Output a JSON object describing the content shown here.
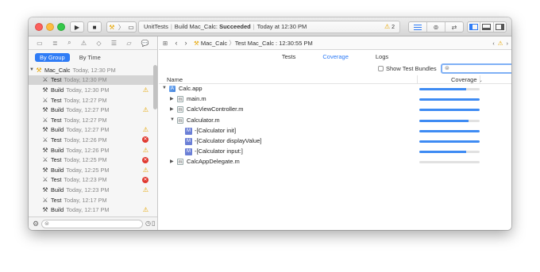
{
  "toolbar": {
    "run_label": "▶",
    "stop_label": "■",
    "activity": {
      "project": "UnitTests",
      "action": "Build Mac_Calc:",
      "status": "Succeeded",
      "time": "Today at 12:30 PM",
      "warning_count": "2"
    }
  },
  "navigator": {
    "filter": {
      "by_group": "By Group",
      "by_time": "By Time"
    },
    "root": {
      "name": "Mac_Calc",
      "time": "Today, 12:30 PM"
    },
    "items": [
      {
        "action": "Test",
        "time": "Today, 12:30 PM",
        "badge": "none",
        "selected": true
      },
      {
        "action": "Build",
        "time": "Today, 12:30 PM",
        "badge": "warning"
      },
      {
        "action": "Test",
        "time": "Today, 12:27 PM",
        "badge": "none"
      },
      {
        "action": "Build",
        "time": "Today, 12:27 PM",
        "badge": "warning"
      },
      {
        "action": "Test",
        "time": "Today, 12:27 PM",
        "badge": "none"
      },
      {
        "action": "Build",
        "time": "Today, 12:27 PM",
        "badge": "warning"
      },
      {
        "action": "Test",
        "time": "Today, 12:26 PM",
        "badge": "error"
      },
      {
        "action": "Build",
        "time": "Today, 12:26 PM",
        "badge": "warning"
      },
      {
        "action": "Test",
        "time": "Today, 12:25 PM",
        "badge": "error"
      },
      {
        "action": "Build",
        "time": "Today, 12:25 PM",
        "badge": "warning"
      },
      {
        "action": "Test",
        "time": "Today, 12:23 PM",
        "badge": "error"
      },
      {
        "action": "Build",
        "time": "Today, 12:23 PM",
        "badge": "warning"
      },
      {
        "action": "Test",
        "time": "Today, 12:17 PM",
        "badge": "none"
      },
      {
        "action": "Build",
        "time": "Today, 12:17 PM",
        "badge": "warning"
      }
    ]
  },
  "jump_bar": {
    "project": "Mac_Calc",
    "separator": "〉",
    "report": "Test Mac_Calc : 12:30:55 PM"
  },
  "tabs": [
    {
      "label": "Tests",
      "active": false
    },
    {
      "label": "Coverage",
      "active": true
    },
    {
      "label": "Logs",
      "active": false
    }
  ],
  "options": {
    "show_test_bundles": "Show Test Bundles"
  },
  "coverage": {
    "header": {
      "name": "Name",
      "coverage": "Coverage"
    },
    "rows": [
      {
        "name": "Calc.app",
        "kind": "app",
        "disclosure": "▼",
        "indent": 0,
        "value": 0.78
      },
      {
        "name": "main.m",
        "kind": "m",
        "disclosure": "▶",
        "indent": 1,
        "value": 1.0
      },
      {
        "name": "CalcViewController.m",
        "kind": "m",
        "disclosure": "▶",
        "indent": 1,
        "value": 1.0
      },
      {
        "name": "Calculator.m",
        "kind": "m",
        "disclosure": "▼",
        "indent": 1,
        "value": 0.82
      },
      {
        "name": "-[Calculator init]",
        "kind": "method",
        "disclosure": "",
        "indent": 2,
        "value": 1.0
      },
      {
        "name": "-[Calculator displayValue]",
        "kind": "method",
        "disclosure": "",
        "indent": 2,
        "value": 1.0
      },
      {
        "name": "-[Calculator input:]",
        "kind": "method",
        "disclosure": "",
        "indent": 2,
        "value": 0.78
      },
      {
        "name": "CalcAppDelegate.m",
        "kind": "m",
        "disclosure": "▶",
        "indent": 1,
        "value": 0.0
      }
    ]
  },
  "colors": {
    "accent": "#2f7cf6",
    "bar_fill": "#3e8bf3",
    "warning": "#e6a500",
    "error": "#e0382f"
  }
}
